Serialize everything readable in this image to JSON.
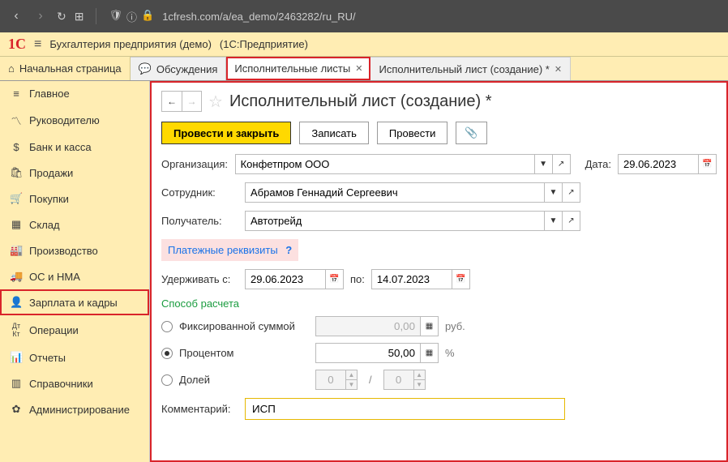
{
  "browser": {
    "url": "1cfresh.com/a/ea_demo/2463282/ru_RU/"
  },
  "header": {
    "app_name": "Бухгалтерия предприятия (демо)",
    "platform": "(1С:Предприятие)"
  },
  "tabs": {
    "home": "Начальная страница",
    "discuss": "Обсуждения",
    "sheets": "Исполнительные листы",
    "create": "Исполнительный лист (создание) *"
  },
  "sidebar": {
    "items": [
      {
        "label": "Главное",
        "icon": "≡"
      },
      {
        "label": "Руководителю",
        "icon": "📈"
      },
      {
        "label": "Банк и касса",
        "icon": "💰"
      },
      {
        "label": "Продажи",
        "icon": "🛍"
      },
      {
        "label": "Покупки",
        "icon": "🛒"
      },
      {
        "label": "Склад",
        "icon": "▦"
      },
      {
        "label": "Производство",
        "icon": "🏭"
      },
      {
        "label": "ОС и НМА",
        "icon": "🚚"
      },
      {
        "label": "Зарплата и кадры",
        "icon": "👤"
      },
      {
        "label": "Операции",
        "icon": "ᴬᵀ"
      },
      {
        "label": "Отчеты",
        "icon": "📊"
      },
      {
        "label": "Справочники",
        "icon": "📚"
      },
      {
        "label": "Администрирование",
        "icon": "⚙"
      }
    ]
  },
  "content": {
    "title": "Исполнительный лист (создание) *",
    "toolbar": {
      "post_close": "Провести и закрыть",
      "save": "Записать",
      "post": "Провести"
    },
    "labels": {
      "org": "Организация:",
      "emp": "Сотрудник:",
      "recv": "Получатель:",
      "date": "Дата:",
      "hold_from": "Удерживать с:",
      "to": "по:",
      "pay_req": "Платежные реквизиты",
      "calc_method": "Способ расчета",
      "comment": "Комментарий:"
    },
    "fields": {
      "org": "Конфетпром ООО",
      "emp": "Абрамов Геннадий Сергеевич",
      "recv": "Автотрейд",
      "date": "29.06.2023",
      "hold_from": "29.06.2023",
      "hold_to": "14.07.2023",
      "fixed_amount": "0,00",
      "percent": "50,00",
      "frac_num": "0",
      "frac_den": "0",
      "comment": "ИСП"
    },
    "radios": {
      "fixed": "Фиксированной суммой",
      "percent": "Процентом",
      "fraction": "Долей"
    },
    "units": {
      "rub": "руб.",
      "pct": "%"
    }
  }
}
